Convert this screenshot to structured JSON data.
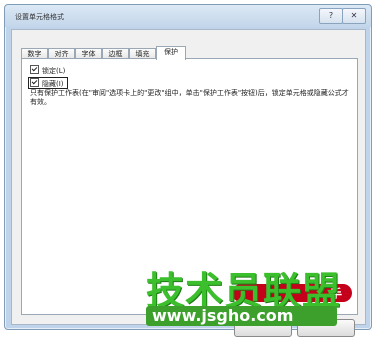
{
  "window": {
    "title": "设置单元格格式",
    "help_glyph": "?",
    "close_glyph": "✕"
  },
  "tabs": [
    {
      "label": "数字"
    },
    {
      "label": "对齐"
    },
    {
      "label": "字体"
    },
    {
      "label": "边框"
    },
    {
      "label": "填充"
    },
    {
      "label": "保护",
      "active": true
    }
  ],
  "protection": {
    "locked_label": "锁定(L)",
    "locked_checked": true,
    "hidden_label": "隐藏(I)",
    "hidden_checked": true,
    "description": "只有保护工作表(在\"审阅\"选项卡上的\"更改\"组中，单击\"保护工作表\"按钮)后，锁定单元格或隐藏公式才有效。"
  },
  "watermark": {
    "brand": "技术员联盟",
    "pill_text": "手",
    "url": "www.jsgho.com",
    "tld": ".com"
  },
  "colors": {
    "frame": "#bfd4ea",
    "watermark_green": "#3cbf2c",
    "watermark_red": "#c4001b"
  }
}
